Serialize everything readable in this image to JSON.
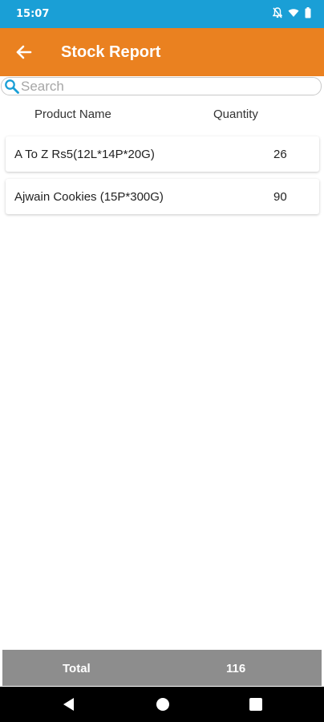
{
  "status_bar": {
    "time": "15:07",
    "icons": [
      "notifications-off-icon",
      "wifi-icon",
      "battery-icon"
    ]
  },
  "app_bar": {
    "title": "Stock Report",
    "back_icon": "arrow-left-icon"
  },
  "search": {
    "placeholder": "Search",
    "value": ""
  },
  "table": {
    "headers": [
      "Product Name",
      "Quantity"
    ],
    "rows": [
      {
        "name": "A To Z Rs5(12L*14P*20G)",
        "quantity": "26"
      },
      {
        "name": "Ajwain Cookies (15P*300G)",
        "quantity": "90"
      }
    ]
  },
  "footer": {
    "total_label": "Total",
    "total_value": "116"
  },
  "nav_bar": {
    "icons": [
      "back-triangle-icon",
      "home-circle-icon",
      "recents-square-icon"
    ]
  },
  "colors": {
    "status_bar": "#1a9fd6",
    "app_bar": "#ea8120",
    "total_bar": "#8d8d8d",
    "search_icon": "#1a9fd6"
  }
}
